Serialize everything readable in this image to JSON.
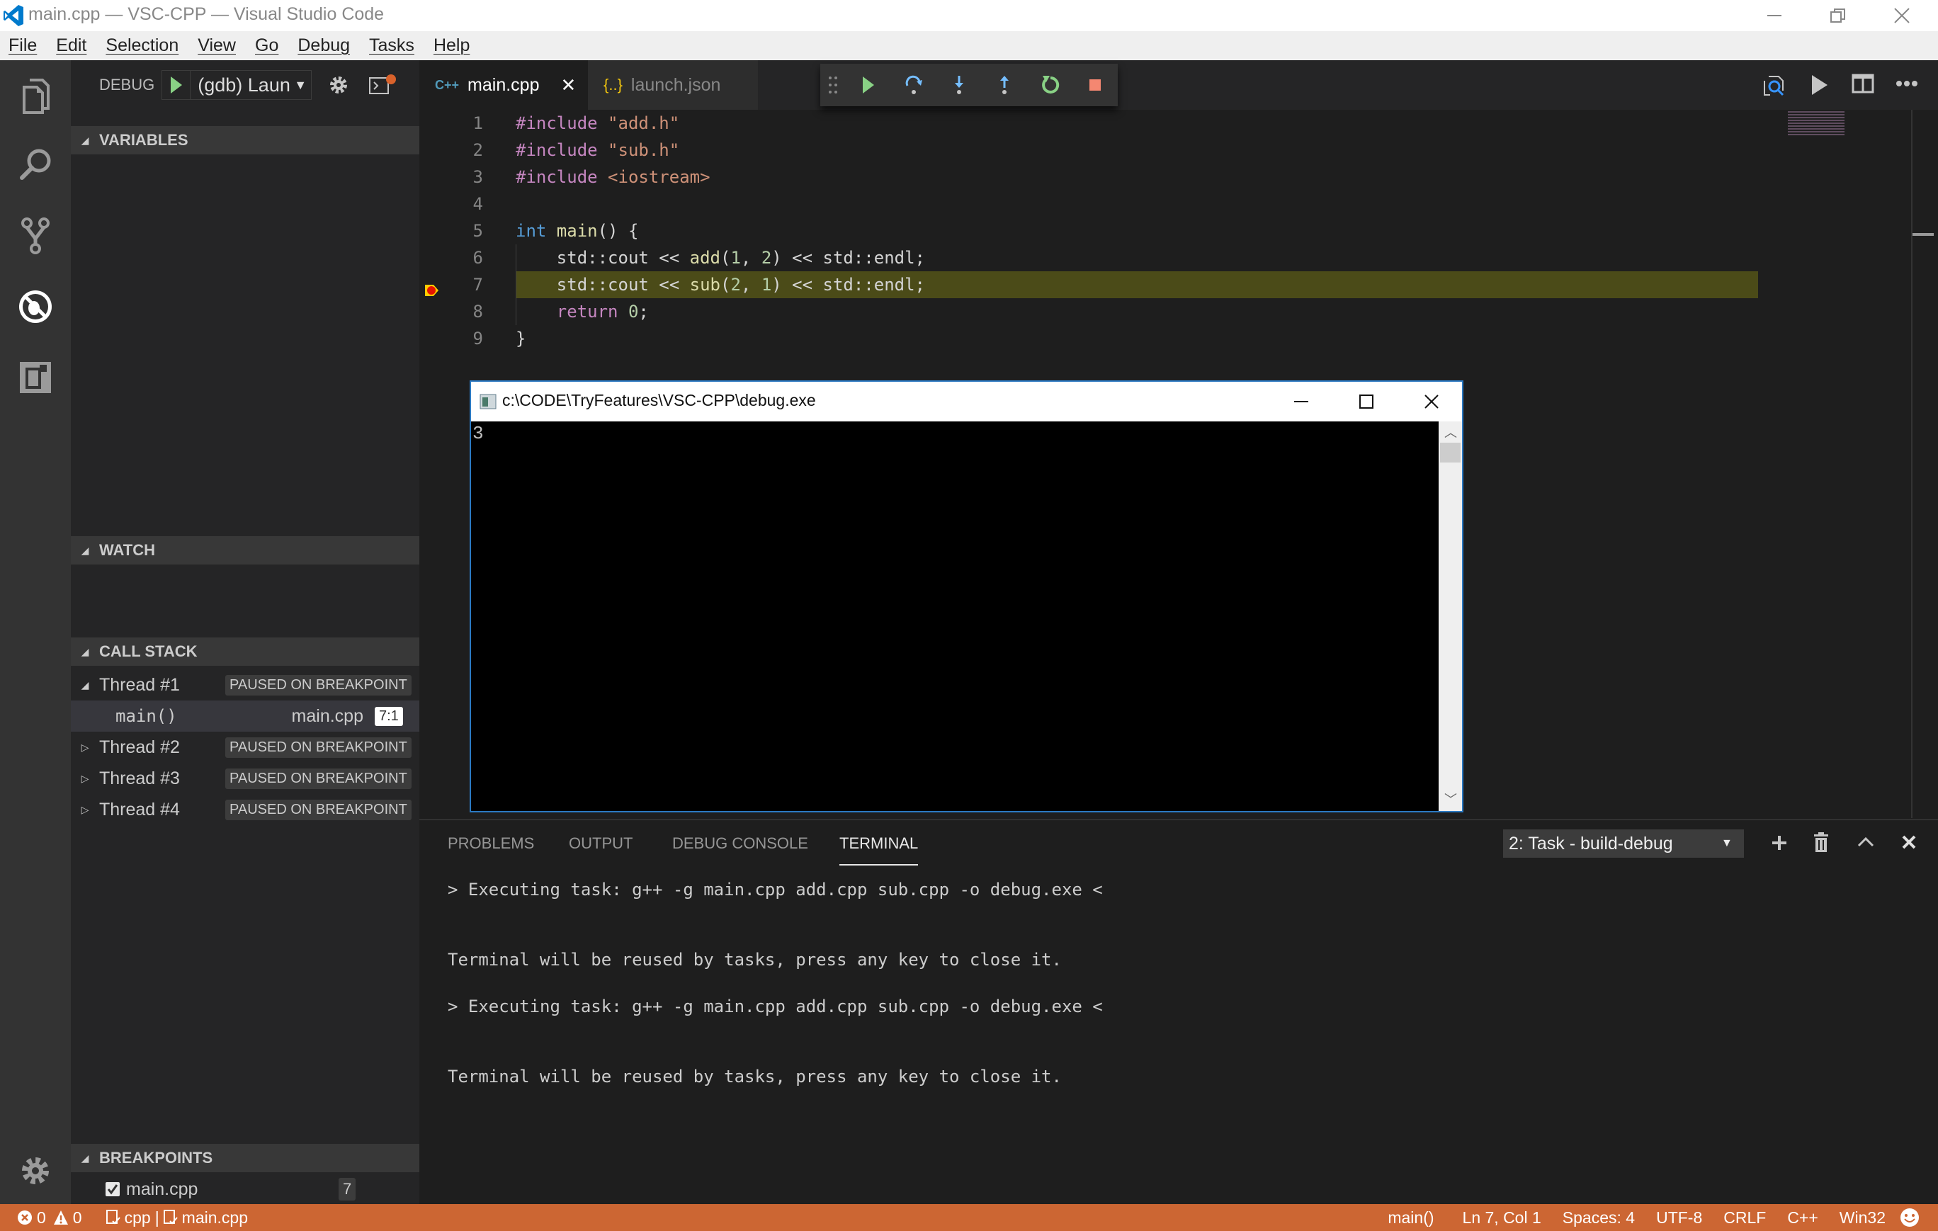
{
  "window": {
    "title": "main.cpp — VSC-CPP — Visual Studio Code",
    "controls": [
      "minimize",
      "restore",
      "close"
    ]
  },
  "menu": [
    "File",
    "Edit",
    "Selection",
    "View",
    "Go",
    "Debug",
    "Tasks",
    "Help"
  ],
  "activity_bar": {
    "items": [
      "explorer-icon",
      "search-icon",
      "source-control-icon",
      "debug-icon",
      "extensions-icon"
    ],
    "bottom": "gear-icon"
  },
  "sidebar": {
    "debug_label": "DEBUG",
    "config_name": "(gdb) Launch",
    "sections": {
      "variables": "VARIABLES",
      "watch": "WATCH",
      "call_stack": "CALL STACK",
      "breakpoints": "BREAKPOINTS"
    },
    "threads": [
      {
        "name": "Thread #1",
        "status": "PAUSED ON BREAKPOINT",
        "expanded": true
      },
      {
        "name": "Thread #2",
        "status": "PAUSED ON BREAKPOINT",
        "expanded": false
      },
      {
        "name": "Thread #3",
        "status": "PAUSED ON BREAKPOINT",
        "expanded": false
      },
      {
        "name": "Thread #4",
        "status": "PAUSED ON BREAKPOINT",
        "expanded": false
      }
    ],
    "frame": {
      "function": "main()",
      "file": "main.cpp",
      "position": "7:1"
    },
    "breakpoints": [
      {
        "file": "main.cpp",
        "line": "7",
        "enabled": true
      }
    ]
  },
  "tabs": [
    {
      "label": "main.cpp",
      "icon": "C++",
      "active": true
    },
    {
      "label": "launch.json",
      "icon": "{..}",
      "active": false
    }
  ],
  "debug_toolbar": [
    "drag-handle",
    "continue",
    "step-over",
    "step-into",
    "step-out",
    "restart",
    "stop"
  ],
  "editor": {
    "current_line": 7,
    "breakpoint_line": 7,
    "lines": [
      {
        "n": "1",
        "tokens": [
          [
            "k-pre",
            "#include "
          ],
          [
            "k-str",
            "\"add.h\""
          ]
        ]
      },
      {
        "n": "2",
        "tokens": [
          [
            "k-pre",
            "#include "
          ],
          [
            "k-str",
            "\"sub.h\""
          ]
        ]
      },
      {
        "n": "3",
        "tokens": [
          [
            "k-pre",
            "#include "
          ],
          [
            "k-str",
            "<iostream>"
          ]
        ]
      },
      {
        "n": "4",
        "tokens": []
      },
      {
        "n": "5",
        "tokens": [
          [
            "k-type",
            "int "
          ],
          [
            "k-fn",
            "main"
          ],
          [
            "",
            "() {"
          ]
        ]
      },
      {
        "n": "6",
        "tokens": [
          [
            "",
            "    std::cout << "
          ],
          [
            "k-fn",
            "add"
          ],
          [
            "",
            "("
          ],
          [
            "k-num",
            "1"
          ],
          [
            "",
            ", "
          ],
          [
            "k-num",
            "2"
          ],
          [
            "",
            ") << std::endl;"
          ]
        ]
      },
      {
        "n": "7",
        "tokens": [
          [
            "",
            "    std::cout << "
          ],
          [
            "k-fn",
            "sub"
          ],
          [
            "",
            "("
          ],
          [
            "k-num",
            "2"
          ],
          [
            "",
            ", "
          ],
          [
            "k-num",
            "1"
          ],
          [
            "",
            ") << std::endl;"
          ]
        ]
      },
      {
        "n": "8",
        "tokens": [
          [
            "k-ret",
            "    return "
          ],
          [
            "k-num",
            "0"
          ],
          [
            "",
            ";"
          ]
        ]
      },
      {
        "n": "9",
        "tokens": [
          [
            "",
            "}"
          ]
        ]
      }
    ]
  },
  "console_window": {
    "title": "c:\\CODE\\TryFeatures\\VSC-CPP\\debug.exe",
    "output": "3"
  },
  "panel": {
    "tabs": [
      "PROBLEMS",
      "OUTPUT",
      "DEBUG CONSOLE",
      "TERMINAL"
    ],
    "active_tab": "TERMINAL",
    "terminal_select": "2: Task - build-debug",
    "terminal_lines": [
      "> Executing task: g++ -g main.cpp add.cpp sub.cpp -o debug.exe <",
      "Terminal will be reused by tasks, press any key to close it.",
      "> Executing task: g++ -g main.cpp add.cpp sub.cpp -o debug.exe <",
      "Terminal will be reused by tasks, press any key to close it."
    ]
  },
  "status_bar": {
    "errors": "0",
    "warnings": "0",
    "left_items": [
      "cpp",
      "main.cpp"
    ],
    "function": "main()",
    "cursor": "Ln 7, Col 1",
    "indent": "Spaces: 4",
    "encoding": "UTF-8",
    "eol": "CRLF",
    "language": "C++",
    "platform": "Win32",
    "color": "#cc6633"
  }
}
